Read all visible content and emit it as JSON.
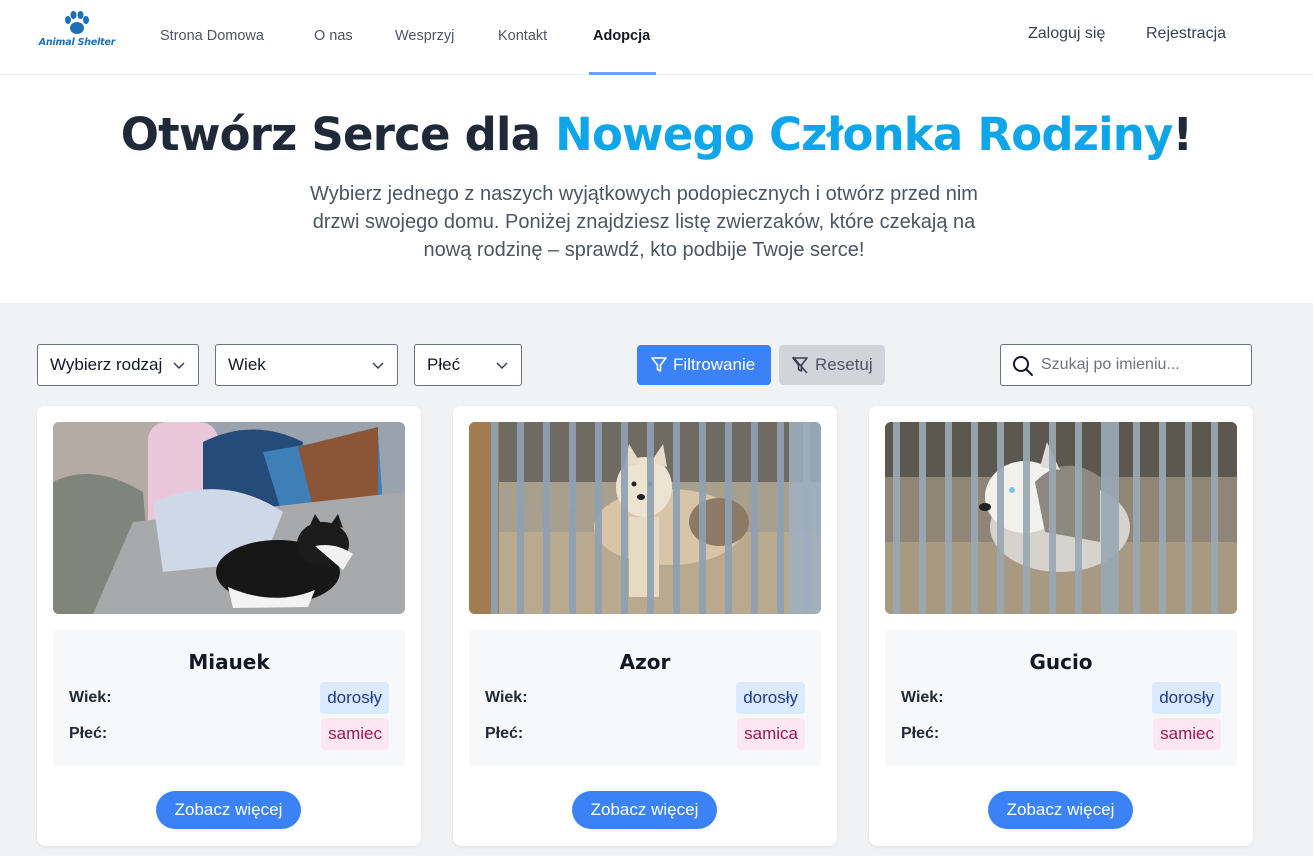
{
  "brand": {
    "name": "Animal Shelter",
    "accent": "#1d6fb8"
  },
  "nav": {
    "links": [
      "Strona Domowa",
      "O nas",
      "Wesprzyj",
      "Kontakt",
      "Adopcja"
    ],
    "active": "Adopcja",
    "login": "Zaloguj się",
    "register": "Rejestracja"
  },
  "hero": {
    "title_start": "Otwórz Serce dla ",
    "title_accent": "Nowego Członka Rodziny",
    "title_end": "!",
    "accent_color": "#0ea5e9",
    "subtitle": "Wybierz jednego z naszych wyjątkowych podopiecznych i otwórz przed nim drzwi swojego domu. Poniżej znajdziesz listę zwierzaków, które czekają na nową rodzinę – sprawdź, kto podbije Twoje serce!"
  },
  "filters": {
    "type_select": "Wybierz rodzaj",
    "age_select": "Wiek",
    "sex_select": "Płeć",
    "filter_button": "Filtrowanie",
    "reset_button": "Resetuj",
    "search_placeholder": "Szukaj po imieniu...",
    "search_value": ""
  },
  "labels": {
    "age": "Wiek:",
    "sex": "Płeć:",
    "more": "Zobacz więcej"
  },
  "pets": [
    {
      "name": "Miauek",
      "age": "dorosły",
      "sex": "samiec",
      "photo": "cat-on-blanket"
    },
    {
      "name": "Azor",
      "age": "dorosły",
      "sex": "samica",
      "photo": "dog-behind-bars"
    },
    {
      "name": "Gucio",
      "age": "dorosły",
      "sex": "samiec",
      "photo": "husky-behind-bars"
    }
  ],
  "colors": {
    "primary_button": "#3b82f6",
    "section_bg": "#f1f2f4",
    "age_badge": "#dbeafe",
    "sex_badge": "#fce7f3"
  }
}
